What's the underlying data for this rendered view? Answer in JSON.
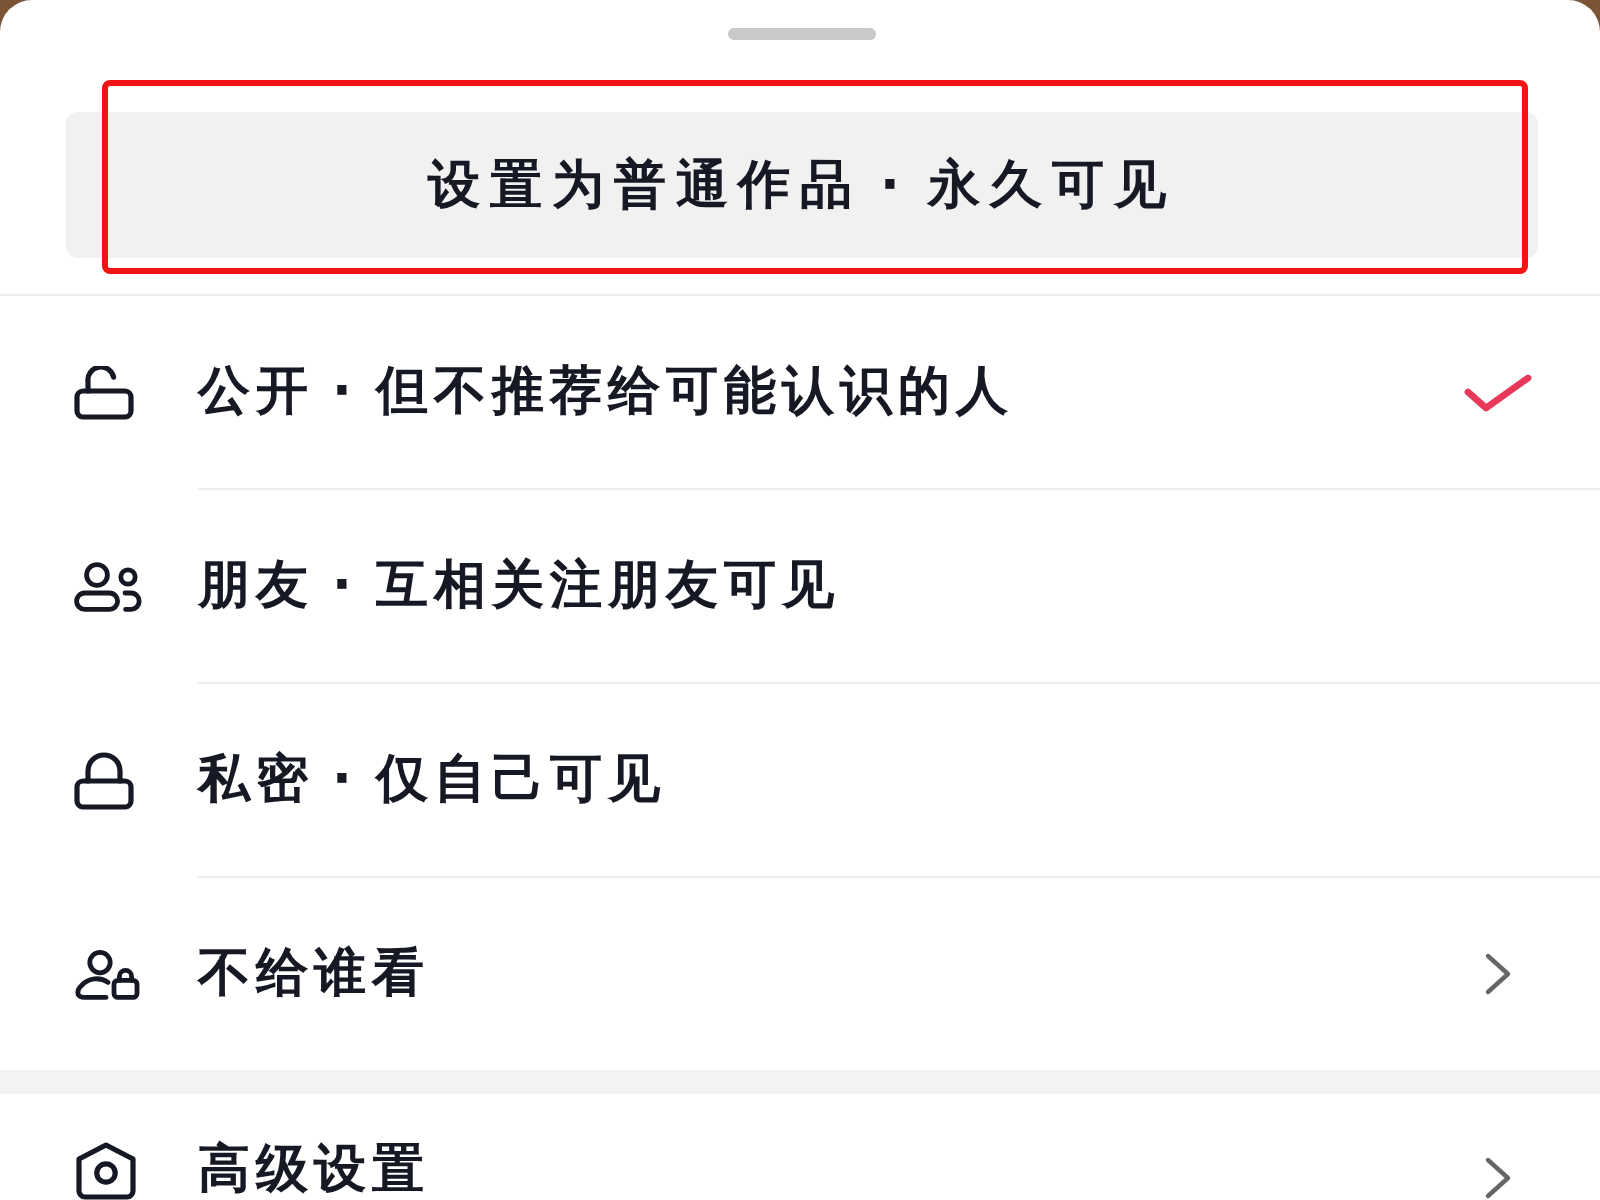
{
  "sheet": {
    "primary_button": {
      "label": "设置为普通作品 · 永久可见",
      "highlighted": true
    },
    "options": [
      {
        "kind": "option",
        "label": "公开 · 但不推荐给可能认识的人",
        "selected": true
      },
      {
        "kind": "option",
        "label": "朋友 · 互相关注朋友可见",
        "selected": false
      },
      {
        "kind": "option",
        "label": "私密 · 仅自己可见",
        "selected": false
      },
      {
        "kind": "submenu",
        "label": "不给谁看",
        "selected": false
      }
    ],
    "more_options": [
      {
        "kind": "submenu",
        "label": "高级设置"
      }
    ]
  }
}
